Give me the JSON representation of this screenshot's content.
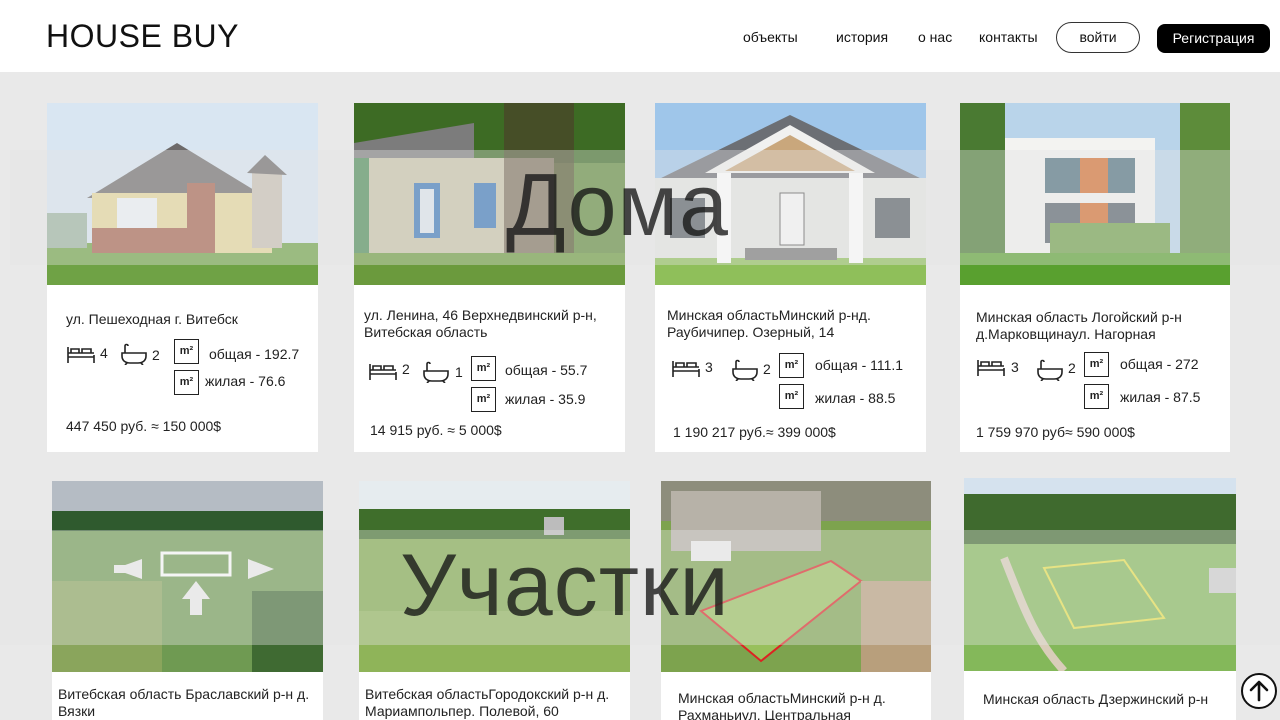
{
  "header": {
    "logo": "HOUSE BUY",
    "nav": [
      "объекты",
      "история",
      "о нас",
      "контакты"
    ],
    "login": "войти",
    "register": "Регистрация"
  },
  "sections": {
    "houses_label": "Дома",
    "plots_label": "Участки"
  },
  "houses": [
    {
      "address": "ул. Пешеходная   г. Витебск",
      "beds": "4",
      "baths": "2",
      "total": "общая - 192.7",
      "living": "жилая - 76.6",
      "price": "447 450 руб.",
      "usd": "150 000$"
    },
    {
      "address": "ул. Ленина, 46  Верхнедвинский р-н, Витебская область",
      "beds": "2",
      "baths": "1",
      "total": "общая - 55.7",
      "living": "жилая - 35.9",
      "price": "14 915 руб.",
      "usd": "5 000$"
    },
    {
      "address": "Минская областьМинский р-нд. Раубичипер. Озерный, 14",
      "beds": "3",
      "baths": "2",
      "total": "общая - 111.1",
      "living": "жилая - 88.5",
      "price": "1 190 217 руб.",
      "usd": "399 000$"
    },
    {
      "address": "Минская область Логойский р-н д.Марковщинаул. Нагорная",
      "beds": "3",
      "baths": "2",
      "total": "общая - 272",
      "living": "жилая - 87.5",
      "price": "1 759 970 руб",
      "usd": "590 000$"
    }
  ],
  "plots": [
    {
      "address": "Витебская область Браславский р-н д. Вязки"
    },
    {
      "address": "Витебская областьГородокский р-н д. Мариампольпер. Полевой, 60"
    },
    {
      "address": "Минская областьМинский р-н д. Рахманьиул. Центральная"
    },
    {
      "address": "Минская область Дзержинский р-н"
    }
  ],
  "approx_symbol": "≈",
  "m2_label": "m²",
  "scroll_top_icon": "arrow-up-circle-icon"
}
